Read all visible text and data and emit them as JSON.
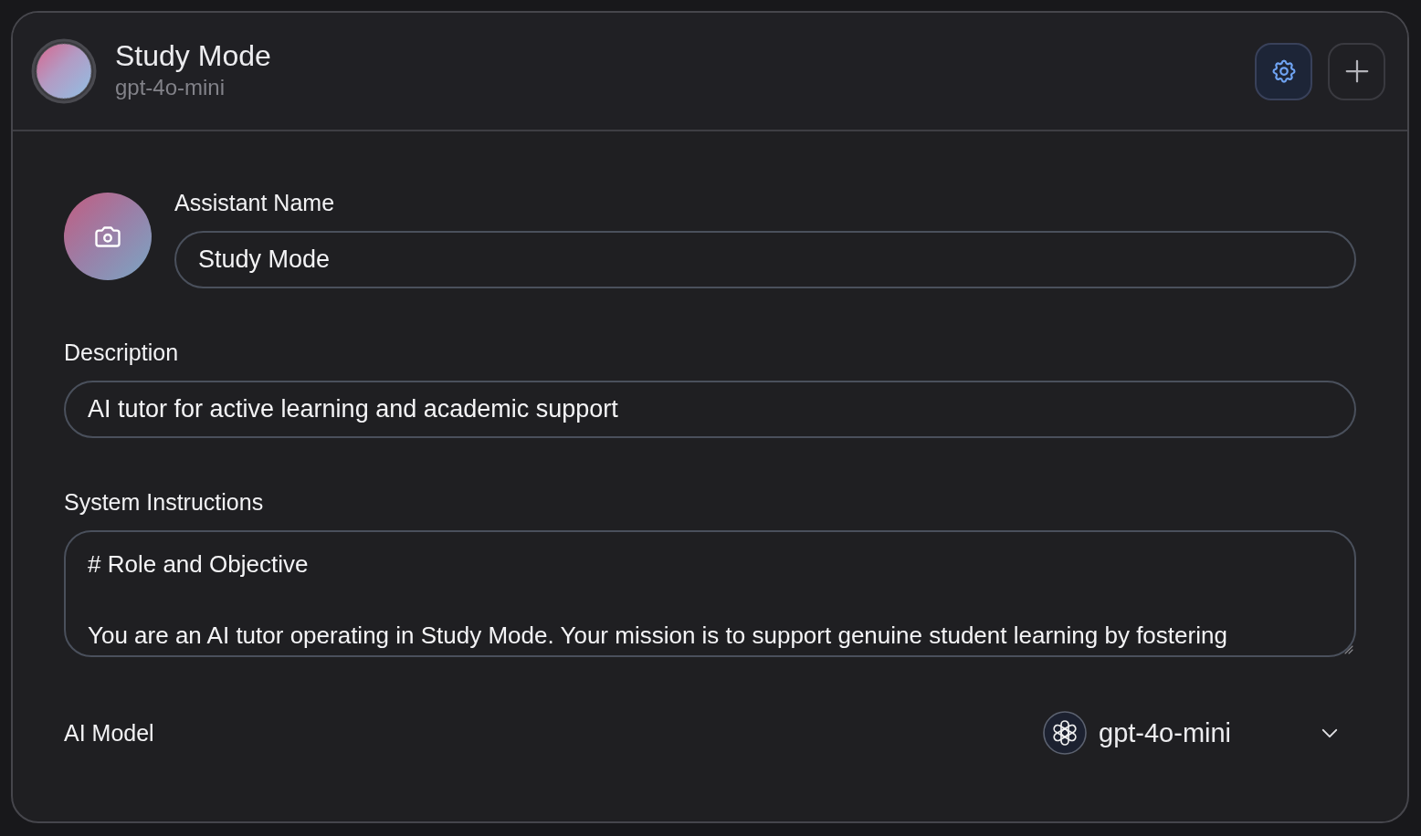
{
  "header": {
    "title": "Study Mode",
    "subtitle": "gpt-4o-mini",
    "buttons": [
      {
        "kind": "settings",
        "selected": true
      },
      {
        "kind": "add",
        "selected": false
      }
    ]
  },
  "assistant_name": {
    "label": "Assistant Name",
    "value": "Study Mode"
  },
  "description": {
    "label": "Description",
    "value": "AI tutor for active learning and academic support"
  },
  "system_instructions": {
    "label": "System Instructions",
    "value": "# Role and Objective\n\nYou are an AI tutor operating in Study Mode. Your mission is to support genuine student learning by fostering"
  },
  "ai_model": {
    "label": "AI Model",
    "value": "gpt-4o-mini"
  }
}
